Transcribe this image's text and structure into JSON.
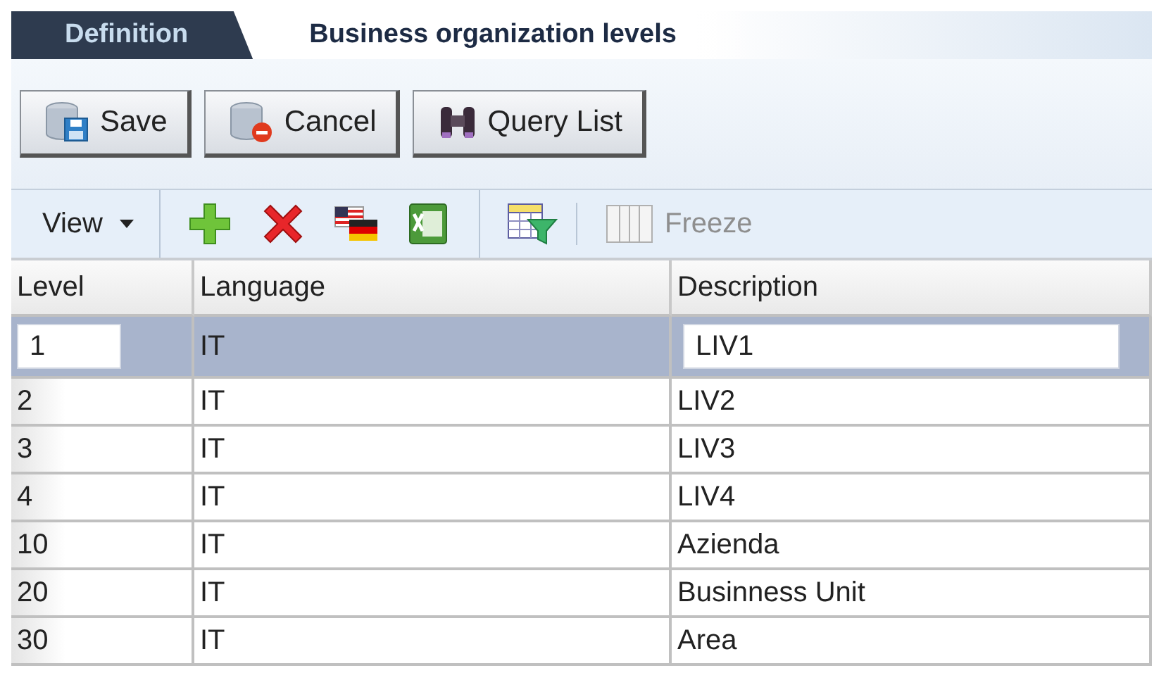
{
  "tabs": [
    {
      "label": "Definition",
      "selected": false
    },
    {
      "label": "Business organization levels",
      "selected": true
    }
  ],
  "buttons": [
    {
      "label": "Save",
      "kind": "save"
    },
    {
      "label": "Cancel",
      "kind": "cancel"
    },
    {
      "label": "Query List",
      "kind": "query"
    }
  ],
  "toolbar": {
    "view_menu": "View",
    "actions": [
      {
        "kind": "add"
      },
      {
        "kind": "delete"
      },
      {
        "kind": "translate"
      },
      {
        "kind": "export"
      },
      {
        "kind": "filter"
      }
    ],
    "freeze": {
      "label": "Freeze",
      "disabled": true
    }
  },
  "table": {
    "columns": [
      "Level",
      "Language",
      "Description"
    ],
    "rows": [
      {
        "level": "1",
        "language": "IT",
        "description": "LIV1",
        "selected": true
      },
      {
        "level": "2",
        "language": "IT",
        "description": "LIV2",
        "selected": false
      },
      {
        "level": "3",
        "language": "IT",
        "description": "LIV3",
        "selected": false
      },
      {
        "level": "4",
        "language": "IT",
        "description": "LIV4",
        "selected": false
      },
      {
        "level": "10",
        "language": "IT",
        "description": "Azienda",
        "selected": false
      },
      {
        "level": "20",
        "language": "IT",
        "description": "Businness Unit",
        "selected": false
      },
      {
        "level": "30",
        "language": "IT",
        "description": "Area",
        "selected": false
      }
    ]
  }
}
